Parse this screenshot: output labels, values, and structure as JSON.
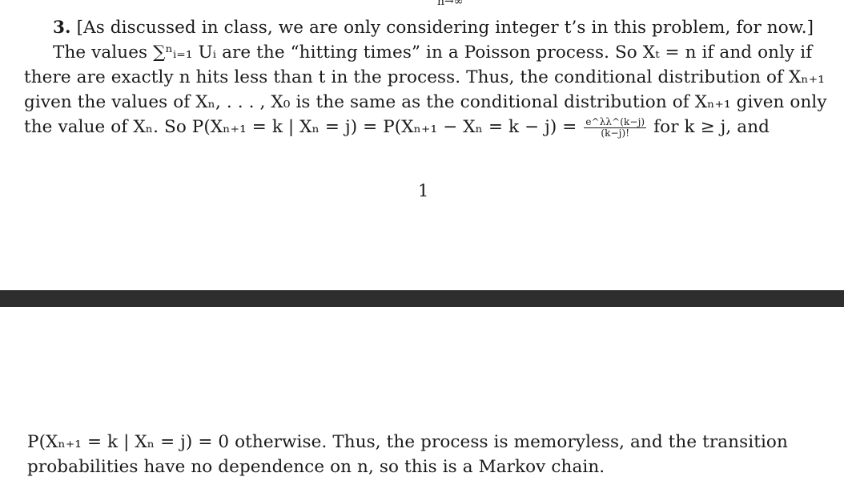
{
  "top_fragment": "n→∞",
  "paragraph": {
    "line1_number": "3.",
    "line1_text": "[As discussed in class, we are only considering integer t’s in this problem, for now.]",
    "line2": "The values ∑ⁿᵢ₌₁ Uᵢ are the “hitting times” in a Poisson process. So Xₜ = n if and only if",
    "line3": "there are exactly n hits less than t in the process. Thus, the conditional distribution of Xₙ₊₁",
    "line4": "given the values of Xₙ, . . . , X₀ is the same as the conditional distribution of Xₙ₊₁ given only",
    "line5_before": "the value of Xₙ. So P(Xₙ₊₁ = k | Xₙ = j) = P(Xₙ₊₁ − Xₙ = k − j) =",
    "line5_frac_num": "e^λλ^(k−j)",
    "line5_frac_den": "(k−j)!",
    "line5_after": "for k ≥ j, and"
  },
  "page_number": "1",
  "continuation": {
    "line1": "P(Xₙ₊₁ = k | Xₙ = j) = 0 otherwise. Thus, the process is memoryless, and the transition",
    "line2": "probabilities have no dependence on n, so this is a Markov chain."
  }
}
